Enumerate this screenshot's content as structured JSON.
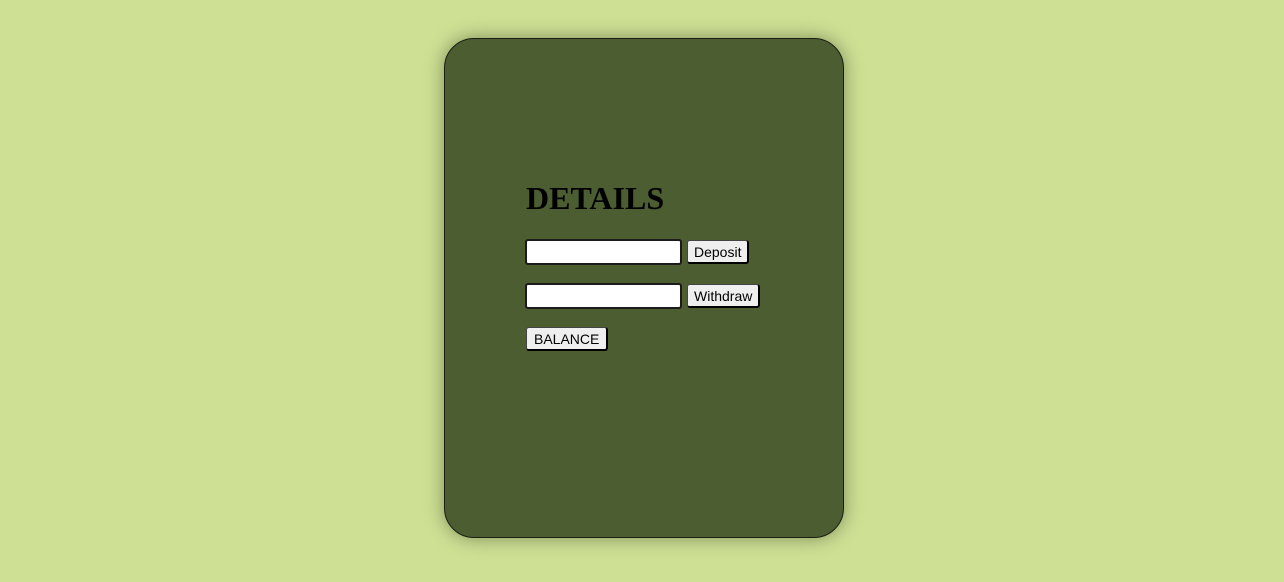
{
  "card": {
    "title": "DETAILS",
    "deposit": {
      "value": "",
      "placeholder": "",
      "button_label": "Deposit"
    },
    "withdraw": {
      "value": "",
      "placeholder": "",
      "button_label": "Withdraw"
    },
    "balance_button_label": "BALANCE"
  },
  "colors": {
    "page_background": "#cde094",
    "card_background": "#4b5d31",
    "title_text": "#000000",
    "button_background": "#efefef"
  }
}
